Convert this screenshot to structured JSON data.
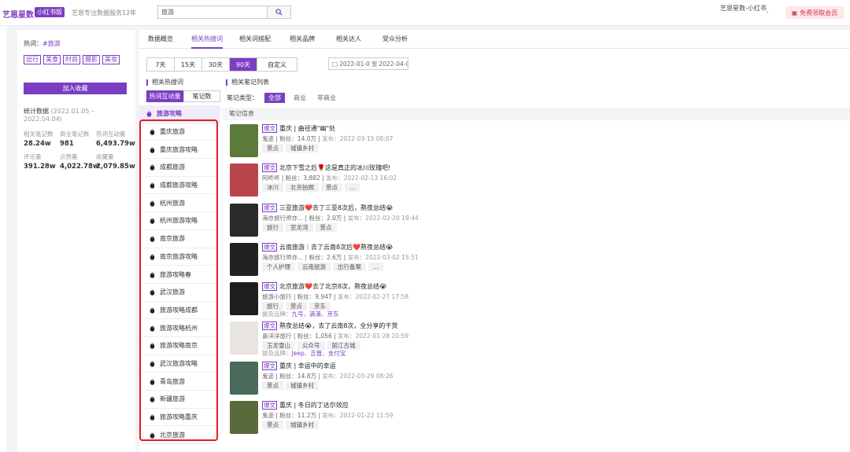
{
  "header": {
    "brand": "艺恩星数",
    "brand_badge": "小红书版",
    "slogan": "艺恩专注数据服务12年",
    "search_value": "旅游",
    "user": "艺恩星数-小红书",
    "vip": "免费领取会员"
  },
  "left": {
    "hot_label": "热词：",
    "hot_word": "#旅游",
    "tags": [
      "出行",
      "美食",
      "时尚",
      "摄影",
      "美妆"
    ],
    "fav_button": "加入收藏",
    "stat_label": "统计数据",
    "stat_range": "(2022.01.05 – 2022.04.04)",
    "stats_row1": [
      {
        "label": "相关笔记数",
        "value": "28.24w"
      },
      {
        "label": "商业笔记数",
        "value": "981"
      },
      {
        "label": "热词互动量",
        "value": "6,493.79w"
      }
    ],
    "stats_row2": [
      {
        "label": "评论量",
        "value": "391.28w"
      },
      {
        "label": "点赞量",
        "value": "4,022.78w"
      },
      {
        "label": "收藏量",
        "value": "2,079.85w"
      }
    ]
  },
  "tabs": [
    "数据概览",
    "相关热搜词",
    "相关词搭配",
    "相关品牌",
    "相关达人",
    "受众分析"
  ],
  "ranges": [
    "7天",
    "15天",
    "30天",
    "90天",
    "自定义"
  ],
  "date_from": "2022-01-0",
  "date_sep": "至",
  "date_to": "2022-04-0",
  "left_section": "相关热搜词",
  "right_section": "相关笔记列表",
  "toggle": [
    "热词互动量",
    "笔记数"
  ],
  "keywords": [
    "旅游攻略",
    "重庆旅游",
    "重庆旅游攻略",
    "成都旅游",
    "成都旅游攻略",
    "杭州旅游",
    "杭州旅游攻略",
    "南京旅游",
    "南京旅游攻略",
    "旅游攻略春",
    "武汉旅游",
    "旅游攻略成都",
    "旅游攻略杭州",
    "旅游攻略南京",
    "武汉旅游攻略",
    "青岛旅游",
    "新疆旅游",
    "旅游攻略重庆",
    "北京旅游"
  ],
  "filter": {
    "label": "笔记类型：",
    "options": [
      "全部",
      "商业",
      "非商业"
    ]
  },
  "notes_header": "笔记信息",
  "notes": [
    {
      "badge": "爆文",
      "title": "重庆 | 曲径通\"幽\"处",
      "author": "鬼迹",
      "fans": "粉丝：14.0万",
      "pub": "发布：2022-03-15 08:07",
      "tags": [
        "景点",
        "城镇乡村"
      ],
      "brands": "",
      "color": "#5c7a3a"
    },
    {
      "badge": "爆文",
      "title": "北京下雪之后🌹这是真正的冰川玫瑰吧!",
      "author": "阿咚咚",
      "fans": "粉丝：3,882",
      "pub": "发布：2022-02-13 16:02",
      "tags": [
        "冰川",
        "北京拍照",
        "景点",
        "..."
      ],
      "brands": "",
      "color": "#b8464a"
    },
    {
      "badge": "爆文",
      "title": "三亚旅游❤️去了三亚8次后，熬夜总结😭",
      "author": "海亦旅行师亦...",
      "fans": "粉丝：2.0万",
      "pub": "发布：2022-02-20 19:44",
      "tags": [
        "旅行",
        "亚龙湾",
        "景点"
      ],
      "brands": "",
      "color": "#2a2a2a"
    },
    {
      "badge": "爆文",
      "title": "云南旅游｜去了云南8次后❤️熬夜总结😭",
      "author": "海亦旅行师亦...",
      "fans": "粉丝：2.6万",
      "pub": "发布：2022-03-02 15:51",
      "tags": [
        "个人护理",
        "云南旅游",
        "出行备案",
        "..."
      ],
      "brands": "",
      "color": "#222"
    },
    {
      "badge": "爆文",
      "title": "北京旅游❤️去了北京8次，熬夜总结😭",
      "author": "旅游小旅行",
      "fans": "粉丝：9,947",
      "pub": "发布：2022-02-27 17:58",
      "tags": [
        "旅行",
        "景点",
        "京东"
      ],
      "brands": "九号、滴滴、京东",
      "color": "#1e1e1e"
    },
    {
      "badge": "爆文",
      "title": "熬夜总结😭，去了云南8次，全分享的干货",
      "author": "喜洋洋旅行",
      "fans": "粉丝：1,056",
      "pub": "发布：2022-01-28 20:59",
      "tags": [
        "玉龙雪山",
        "公众号",
        "丽江古城"
      ],
      "brands": "Jeep、吉普、支付宝",
      "color": "#e8e4e0"
    },
    {
      "badge": "爆文",
      "title": "重庆 | 幸运中的幸运",
      "author": "鬼迹",
      "fans": "粉丝：14.8万",
      "pub": "发布：2022-03-29 08:26",
      "tags": [
        "景点",
        "城镇乡村"
      ],
      "brands": "",
      "color": "#4a6a5a"
    },
    {
      "badge": "爆文",
      "title": "重庆 | 冬日的丁达尔效应",
      "author": "鬼迹",
      "fans": "粉丝：11.2万",
      "pub": "发布：2022-01-22 11:59",
      "tags": [
        "景点",
        "城镇乡村"
      ],
      "brands": "",
      "color": "#5a6a3a"
    }
  ],
  "brand_prefix": "提及品牌："
}
